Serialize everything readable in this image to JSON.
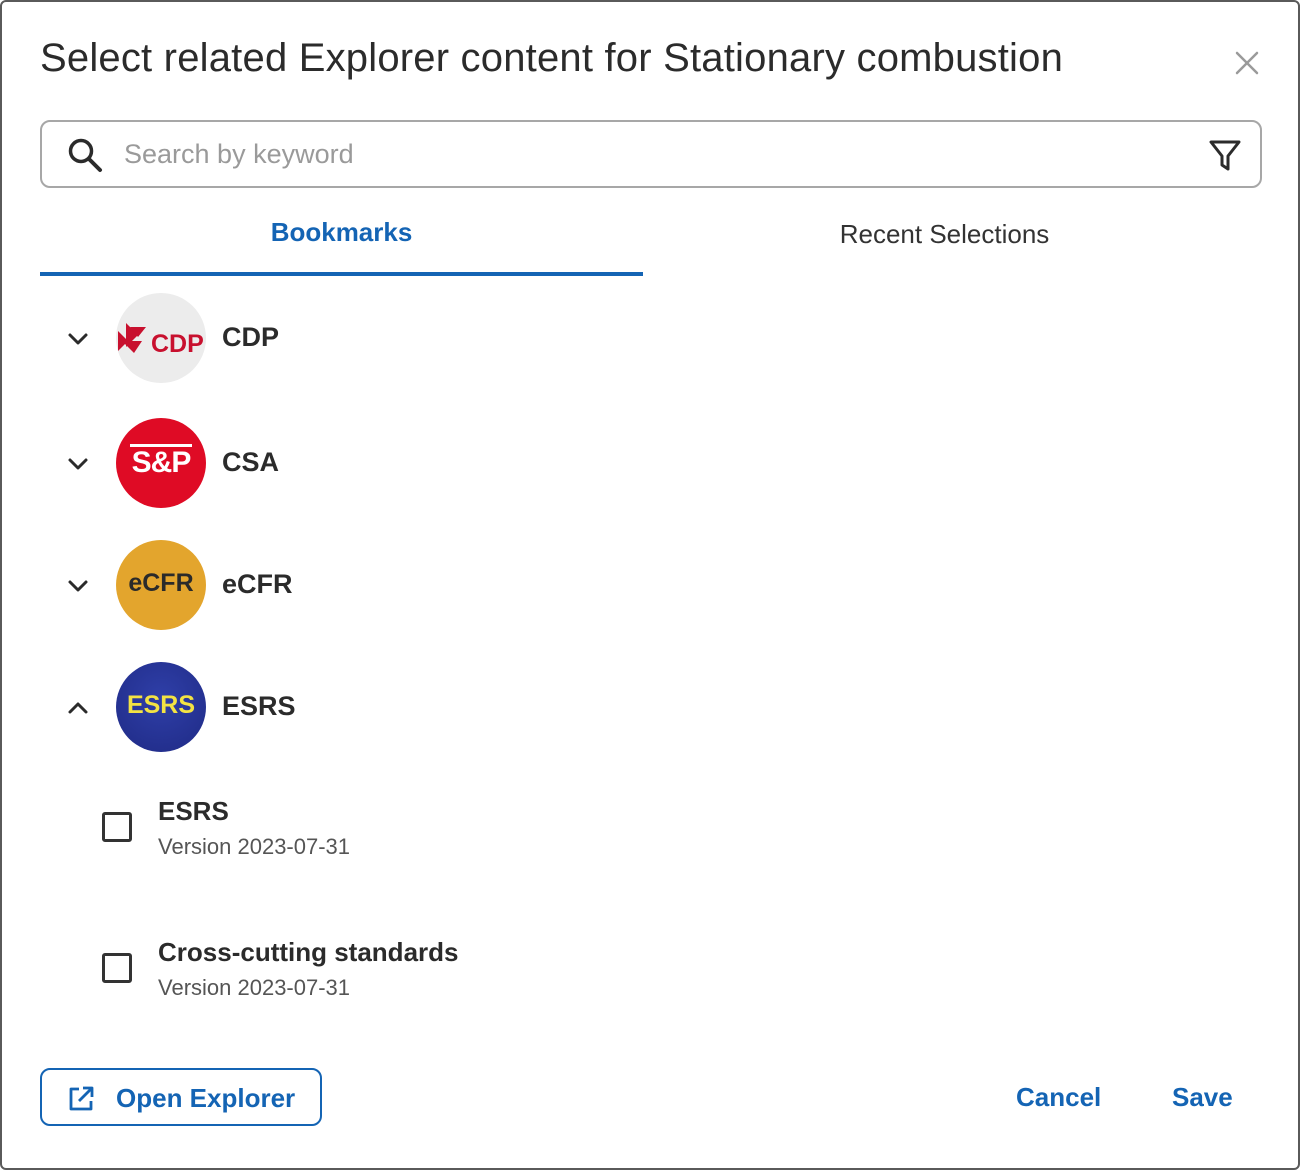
{
  "dialog": {
    "title": "Select related Explorer content for Stationary combustion",
    "close_icon": "close-icon"
  },
  "search": {
    "placeholder": "Search by keyword",
    "value": "",
    "search_icon": "search-icon",
    "filter_icon": "filter-icon"
  },
  "tabs": [
    {
      "label": "Bookmarks",
      "active": true
    },
    {
      "label": "Recent Selections",
      "active": false
    }
  ],
  "groups": [
    {
      "label": "CDP",
      "logo_text": "CDP",
      "expanded": false,
      "logo_color": "#c8102e"
    },
    {
      "label": "CSA",
      "logo_text": "S&P",
      "expanded": false,
      "logo_color": "#df0b25"
    },
    {
      "label": "eCFR",
      "logo_text": "eCFR",
      "expanded": false,
      "logo_color": "#e3a52d"
    },
    {
      "label": "ESRS",
      "logo_text": "ESRS",
      "expanded": true,
      "logo_color": "#25308f"
    }
  ],
  "esrs_items": [
    {
      "title": "ESRS",
      "version": "Version 2023-07-31",
      "checked": false
    },
    {
      "title": "Cross-cutting standards",
      "version": "Version 2023-07-31",
      "checked": false
    }
  ],
  "footer": {
    "open_explorer_label": "Open Explorer",
    "open_explorer_icon": "external-link-icon",
    "cancel_label": "Cancel",
    "save_label": "Save"
  },
  "colors": {
    "accent": "#1464b4",
    "border": "#5a5a5a",
    "text": "#2b2b2b"
  }
}
